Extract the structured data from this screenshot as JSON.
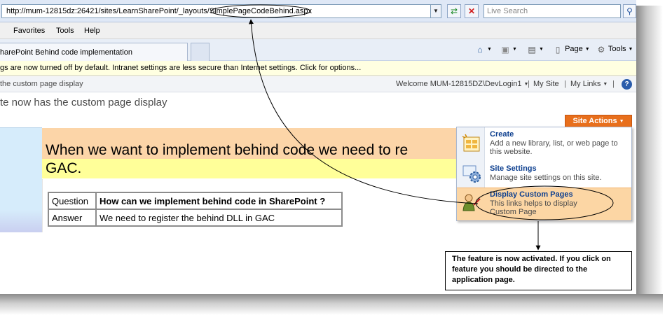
{
  "browser": {
    "address": "http://mum-12815dz:26421/sites/LearnSharePoint/_layouts/SimplePageCodeBehind.aspx",
    "address_dropdown_icon": "chevron-down-icon",
    "refresh_icon": "refresh-icon",
    "stop_icon": "stop-icon",
    "search_placeholder": "Live Search",
    "search_icon": "search-icon"
  },
  "menu": {
    "items": [
      "Favorites",
      "Tools",
      "Help"
    ]
  },
  "tabs": {
    "active_label": "harePoint Behind code implementation"
  },
  "commands": {
    "home_icon": "home-icon",
    "feeds_icon": "feeds-icon",
    "print_icon": "print-icon",
    "page_label": "Page",
    "tools_label": "Tools"
  },
  "info_bar": {
    "text": "gs are now turned off by default. Intranet settings are less secure than Internet settings. Click for options..."
  },
  "sharepoint": {
    "breadcrumb": "the custom page display",
    "welcome": "Welcome MUM-12815DZ\\DevLogin1",
    "my_site": "My Site",
    "my_links": "My Links",
    "help_label": "?",
    "site_title": "te now has the custom page display",
    "site_actions_label": "Site Actions"
  },
  "content": {
    "heading_line1": "When we want to implement behind code we need to re",
    "heading_line2": "GAC.",
    "qa": [
      {
        "label": "Question",
        "value": "How can we implement behind code in SharePoint ?"
      },
      {
        "label": "Answer",
        "value": "We need to register the behind DLL in GAC"
      }
    ]
  },
  "site_actions_menu": {
    "items": [
      {
        "title": "Create",
        "description": "Add a new library, list, or web page to this website.",
        "icon": "create-icon"
      },
      {
        "title": "Site Settings",
        "description": "Manage site settings on this site.",
        "icon": "site-settings-icon"
      },
      {
        "title": "Display Custom Pages",
        "description": "This links helps to display Custom Page",
        "icon": "custom-pages-icon"
      }
    ]
  },
  "callout": {
    "text": "The feature is now activated. If you click on feature you should be directed to the application page."
  },
  "colors": {
    "site_actions": "#e86f1c",
    "heading_band_orange": "#fcd5a8",
    "heading_band_yellow": "#ffff99",
    "highlight_item": "#fcd6a4",
    "info_bar": "#ffffe1"
  }
}
